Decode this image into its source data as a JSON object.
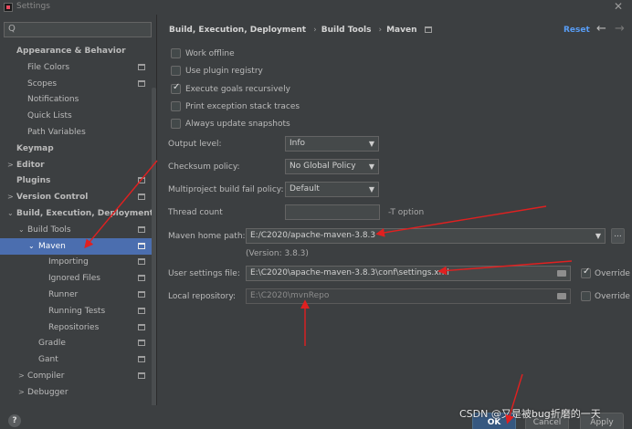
{
  "window": {
    "title": "Settings",
    "close_glyph": "✕"
  },
  "search": {
    "glyph": "Q",
    "value": "",
    "placeholder": ""
  },
  "sidebar": {
    "items": [
      {
        "label": "Appearance & Behavior",
        "indent": 0,
        "arrow": "",
        "bold": true
      },
      {
        "label": "File Colors",
        "indent": 1,
        "arrow": "",
        "bold": false,
        "scope": true
      },
      {
        "label": "Scopes",
        "indent": 1,
        "arrow": "",
        "bold": false,
        "scope": true
      },
      {
        "label": "Notifications",
        "indent": 1,
        "arrow": "",
        "bold": false
      },
      {
        "label": "Quick Lists",
        "indent": 1,
        "arrow": "",
        "bold": false
      },
      {
        "label": "Path Variables",
        "indent": 1,
        "arrow": "",
        "bold": false
      },
      {
        "label": "Keymap",
        "indent": 0,
        "arrow": "",
        "bold": true
      },
      {
        "label": "Editor",
        "indent": 0,
        "arrow": ">",
        "bold": true
      },
      {
        "label": "Plugins",
        "indent": 0,
        "arrow": "",
        "bold": true,
        "scope": true
      },
      {
        "label": "Version Control",
        "indent": 0,
        "arrow": ">",
        "bold": true,
        "scope": true
      },
      {
        "label": "Build, Execution, Deployment",
        "indent": 0,
        "arrow": "⌄",
        "bold": true
      },
      {
        "label": "Build Tools",
        "indent": 1,
        "arrow": "⌄",
        "bold": false,
        "scope": true
      },
      {
        "label": "Maven",
        "indent": 2,
        "arrow": "⌄",
        "bold": false,
        "scope": true,
        "selected": true
      },
      {
        "label": "Importing",
        "indent": 3,
        "arrow": "",
        "bold": false,
        "scope": true
      },
      {
        "label": "Ignored Files",
        "indent": 3,
        "arrow": "",
        "bold": false,
        "scope": true
      },
      {
        "label": "Runner",
        "indent": 3,
        "arrow": "",
        "bold": false,
        "scope": true
      },
      {
        "label": "Running Tests",
        "indent": 3,
        "arrow": "",
        "bold": false,
        "scope": true
      },
      {
        "label": "Repositories",
        "indent": 3,
        "arrow": "",
        "bold": false,
        "scope": true
      },
      {
        "label": "Gradle",
        "indent": 2,
        "arrow": "",
        "bold": false,
        "scope": true
      },
      {
        "label": "Gant",
        "indent": 2,
        "arrow": "",
        "bold": false,
        "scope": true
      },
      {
        "label": "Compiler",
        "indent": 1,
        "arrow": ">",
        "bold": false,
        "scope": true
      },
      {
        "label": "Debugger",
        "indent": 1,
        "arrow": ">",
        "bold": false
      }
    ]
  },
  "breadcrumb": {
    "items": [
      "Build, Execution, Deployment",
      "Build Tools",
      "Maven"
    ],
    "separator": "›",
    "reset": "Reset",
    "back_glyph": "←",
    "forward_glyph": "→"
  },
  "checkboxes": [
    {
      "label": "Work offline",
      "checked": false
    },
    {
      "label": "Use plugin registry",
      "checked": false
    },
    {
      "label": "Execute goals recursively",
      "checked": true
    },
    {
      "label": "Print exception stack traces",
      "checked": false
    },
    {
      "label": "Always update snapshots",
      "checked": false
    }
  ],
  "check_glyph": "✓",
  "form": {
    "output_level_label": "Output level:",
    "output_level_value": "Info",
    "checksum_label": "Checksum policy:",
    "checksum_value": "No Global Policy",
    "multiproject_label": "Multiproject build fail policy:",
    "multiproject_value": "Default",
    "thread_count_label": "Thread count",
    "thread_count_value": "",
    "thread_count_hint": "-T option",
    "maven_home_label": "Maven home path:",
    "maven_home_value": "E:/C2020/apache-maven-3.8.3",
    "maven_home_browse": "...",
    "version_text": "(Version: 3.8.3)",
    "user_settings_label": "User settings file:",
    "user_settings_value": "E:\\C2020\\apache-maven-3.8.3\\conf\\settings.xml",
    "user_settings_override": "Override",
    "user_settings_override_checked": true,
    "local_repo_label": "Local repository:",
    "local_repo_value": "E:\\C2020\\mvnRepo",
    "local_repo_override": "Override",
    "local_repo_override_checked": false
  },
  "caret_glyph": "▼",
  "footer": {
    "help": "?",
    "ok": "OK",
    "cancel": "Cancel",
    "apply": "Apply",
    "watermark": "CSDN @又是被bug折磨的一天"
  },
  "colors": {
    "background": "#3c3f41",
    "selection": "#4b6eaf",
    "link": "#589df6",
    "annotation_arrow": "#e02020"
  },
  "icons": [
    "search-icon",
    "scope-icon",
    "folder-icon",
    "close-icon",
    "back-arrow-icon",
    "forward-arrow-icon",
    "help-icon",
    "chevron-down-icon",
    "chevron-right-icon",
    "dropdown-caret-icon"
  ]
}
